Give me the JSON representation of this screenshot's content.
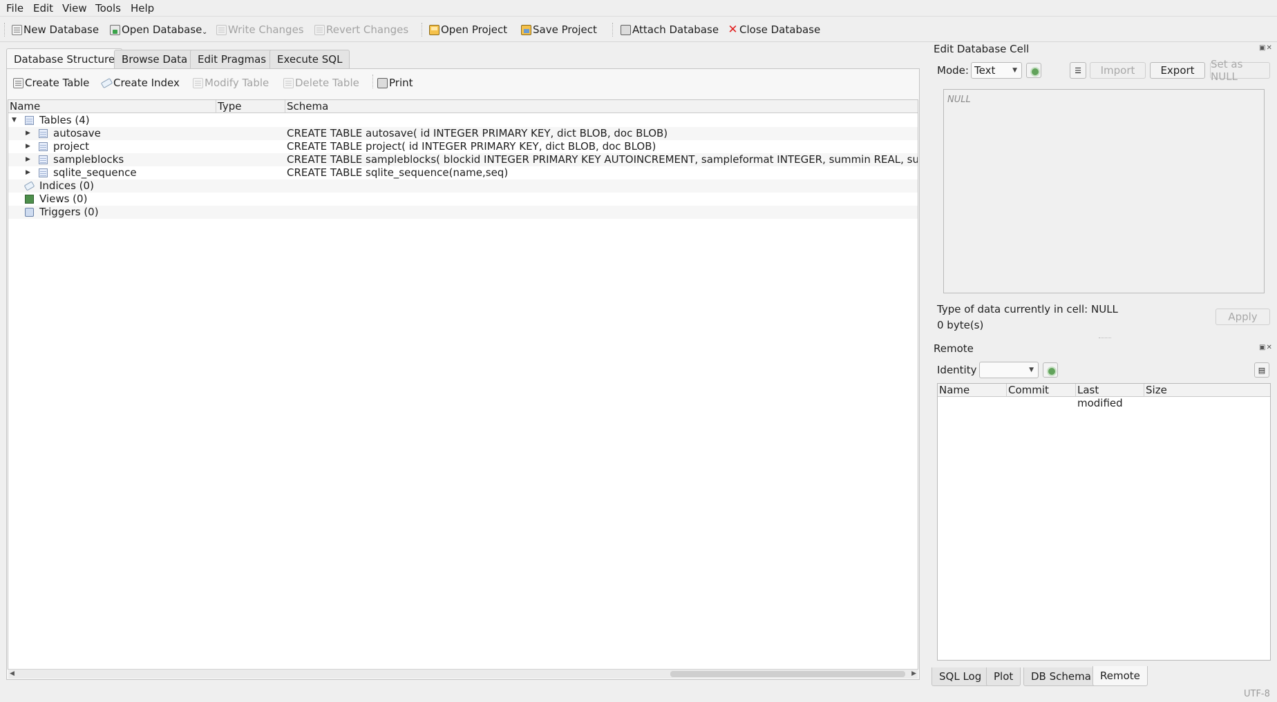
{
  "menu": [
    "File",
    "Edit",
    "View",
    "Tools",
    "Help"
  ],
  "toolbar": {
    "new_database": "New Database",
    "open_database": "Open Database",
    "write_changes": "Write Changes",
    "revert_changes": "Revert Changes",
    "open_project": "Open Project",
    "save_project": "Save Project",
    "attach_database": "Attach Database",
    "close_database": "Close Database"
  },
  "main_tabs": [
    "Database Structure",
    "Browse Data",
    "Edit Pragmas",
    "Execute SQL"
  ],
  "structure_toolbar": {
    "create_table": "Create Table",
    "create_index": "Create Index",
    "modify_table": "Modify Table",
    "delete_table": "Delete Table",
    "print": "Print"
  },
  "tree": {
    "columns": [
      "Name",
      "Type",
      "Schema"
    ],
    "tables_label": "Tables (4)",
    "tables": [
      {
        "name": "autosave",
        "schema": "CREATE TABLE autosave( id INTEGER PRIMARY KEY, dict BLOB, doc BLOB)"
      },
      {
        "name": "project",
        "schema": "CREATE TABLE project( id INTEGER PRIMARY KEY, dict BLOB, doc BLOB)"
      },
      {
        "name": "sampleblocks",
        "schema": "CREATE TABLE sampleblocks( blockid INTEGER PRIMARY KEY AUTOINCREMENT, sampleformat INTEGER, summin REAL, summax REAL,"
      },
      {
        "name": "sqlite_sequence",
        "schema": "CREATE TABLE sqlite_sequence(name,seq)"
      }
    ],
    "indices_label": "Indices (0)",
    "views_label": "Views (0)",
    "triggers_label": "Triggers (0)"
  },
  "edit_cell": {
    "title": "Edit Database Cell",
    "mode_label": "Mode:",
    "mode_value": "Text",
    "import": "Import",
    "export": "Export",
    "set_null": "Set as NULL",
    "editor_text": "NULL",
    "type_info": "Type of data currently in cell: NULL",
    "size_info": "0 byte(s)",
    "apply": "Apply"
  },
  "remote": {
    "title": "Remote",
    "identity_label": "Identity",
    "identity_value": "",
    "columns": [
      "Name",
      "Commit",
      "Last modified",
      "Size"
    ]
  },
  "bottom_tabs": [
    "SQL Log",
    "Plot",
    "DB Schema",
    "Remote"
  ],
  "status": {
    "encoding": "UTF-8"
  }
}
